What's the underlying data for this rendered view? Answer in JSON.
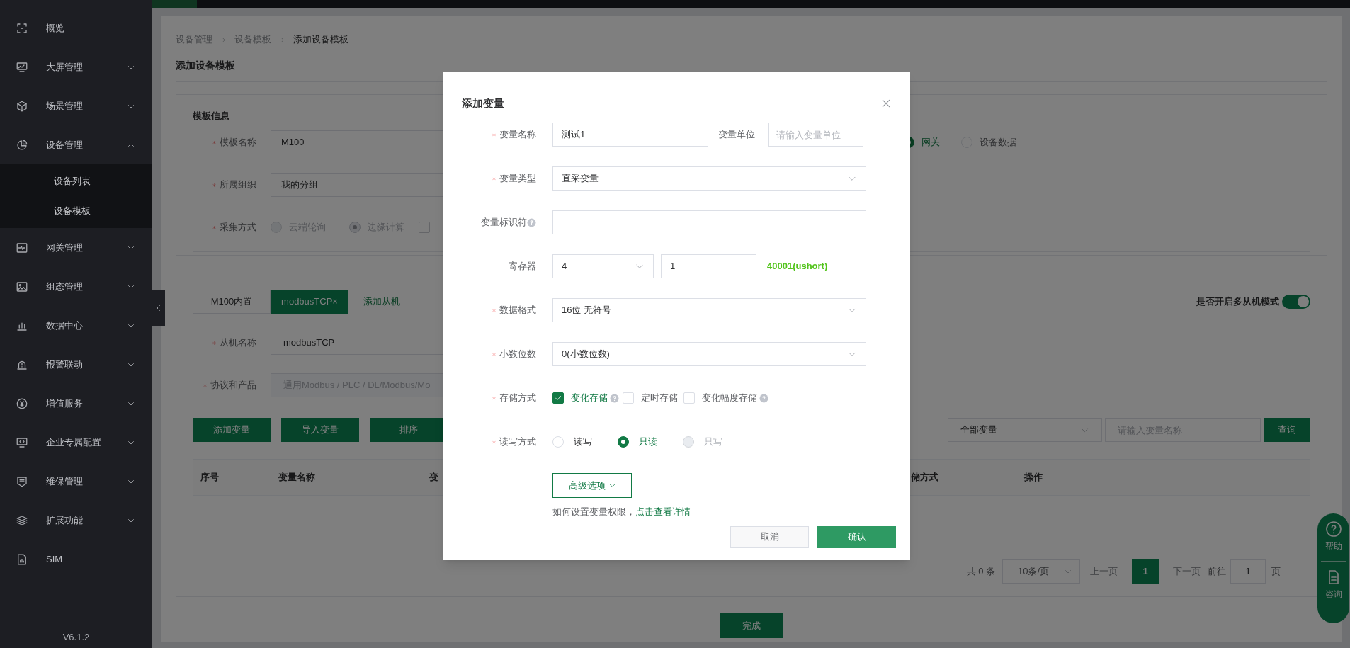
{
  "sidebar": {
    "items": [
      {
        "label": "概览"
      },
      {
        "label": "大屏管理",
        "expanded": false
      },
      {
        "label": "场景管理",
        "expanded": false
      },
      {
        "label": "设备管理",
        "expanded": true,
        "children": [
          {
            "label": "设备列表"
          },
          {
            "label": "设备模板"
          }
        ]
      },
      {
        "label": "网关管理",
        "expanded": false
      },
      {
        "label": "组态管理",
        "expanded": false
      },
      {
        "label": "数据中心",
        "expanded": false
      },
      {
        "label": "报警联动",
        "expanded": false
      },
      {
        "label": "增值服务",
        "expanded": false
      },
      {
        "label": "企业专属配置",
        "expanded": false
      },
      {
        "label": "维保管理",
        "expanded": false
      },
      {
        "label": "扩展功能",
        "expanded": false
      },
      {
        "label": "SIM"
      }
    ],
    "version": "V6.1.2"
  },
  "breadcrumb": [
    "设备管理",
    "设备模板",
    "添加设备模板"
  ],
  "page_title": "添加设备模板",
  "template_info": {
    "title": "模板信息",
    "fields": [
      {
        "label": "模板名称",
        "required": true,
        "value": "M100"
      },
      {
        "label": "所属组织",
        "required": true,
        "value": "我的分组"
      }
    ],
    "collect": {
      "label": "采集方式",
      "required": true,
      "disabled": true,
      "options": [
        {
          "kind": "radio",
          "label": "云端轮询",
          "selected": false
        },
        {
          "kind": "radio",
          "label": "边缘计算",
          "selected": true
        },
        {
          "kind": "checkbox",
          "checked": false
        }
      ]
    },
    "source_options": [
      {
        "label": "网关",
        "selected": true
      },
      {
        "label": "设备数据",
        "selected": false
      }
    ]
  },
  "slaves": {
    "tabs": [
      {
        "label": "M100内置",
        "selected": false
      },
      {
        "label": "modbusTCP×",
        "selected": true
      }
    ],
    "add_link": "添加从机",
    "multi_slave": {
      "label": "是否开启多从机模式",
      "on": true
    },
    "fields": [
      {
        "label": "从机名称",
        "required": true,
        "value": "modbusTCP",
        "disabled": false
      },
      {
        "label": "协议和产品",
        "required": true,
        "value": "通用Modbus / PLC / DL/Modbus/Mo",
        "disabled": true
      }
    ],
    "actions": [
      "添加变量",
      "导入变量",
      "排序"
    ],
    "filter": {
      "value": "全部变量"
    },
    "search": {
      "placeholder": "请输入变量名称"
    },
    "query": "查询",
    "columns": [
      "序号",
      "变量名称",
      "变",
      "储方式",
      "操作"
    ],
    "pagination": {
      "total": "共 0 条",
      "page_size": "10条/页",
      "prev": "上一页",
      "pages": [
        {
          "label": "1",
          "selected": true
        }
      ],
      "next": "下一页",
      "goto": "前往",
      "goto_value": "1",
      "page_unit": "页"
    }
  },
  "done": "完成",
  "float_buttons": [
    "帮助",
    "咨询"
  ],
  "dialog": {
    "title": "添加变量",
    "rows": [
      {
        "kind": "name_unit",
        "label": "变量名称",
        "required": true,
        "value": "测试1",
        "unit_label": "变量单位",
        "unit_placeholder": "请输入变量单位"
      },
      {
        "kind": "select",
        "label": "变量类型",
        "required": true,
        "value": "直采变量"
      },
      {
        "kind": "input",
        "label": "变量标识符",
        "required": false,
        "help": true
      },
      {
        "kind": "register",
        "label": "寄存器",
        "required": false,
        "area": "4",
        "address": "1",
        "hint": "40001(ushort)"
      },
      {
        "kind": "select",
        "label": "数据格式",
        "required": true,
        "value": "16位 无符号"
      },
      {
        "kind": "select",
        "label": "小数位数",
        "required": true,
        "value": "0(小数位数)"
      },
      {
        "kind": "checkboxes",
        "label": "存储方式",
        "required": true,
        "options": [
          {
            "label": "变化存储",
            "checked": true,
            "help": true
          },
          {
            "label": "定时存储",
            "checked": false,
            "help": false
          },
          {
            "label": "变化幅度存储",
            "checked": false,
            "help": true
          }
        ]
      },
      {
        "kind": "radios",
        "label": "读写方式",
        "required": true,
        "options": [
          {
            "label": "读写",
            "selected": false,
            "disabled": false
          },
          {
            "label": "只读",
            "selected": true,
            "disabled": false
          },
          {
            "label": "只写",
            "selected": false,
            "disabled": true
          }
        ]
      }
    ],
    "advanced": "高级选项",
    "hint": "如何设置变量权限，",
    "hint_link": "点击查看详情",
    "cancel": "取消",
    "confirm": "确认"
  }
}
